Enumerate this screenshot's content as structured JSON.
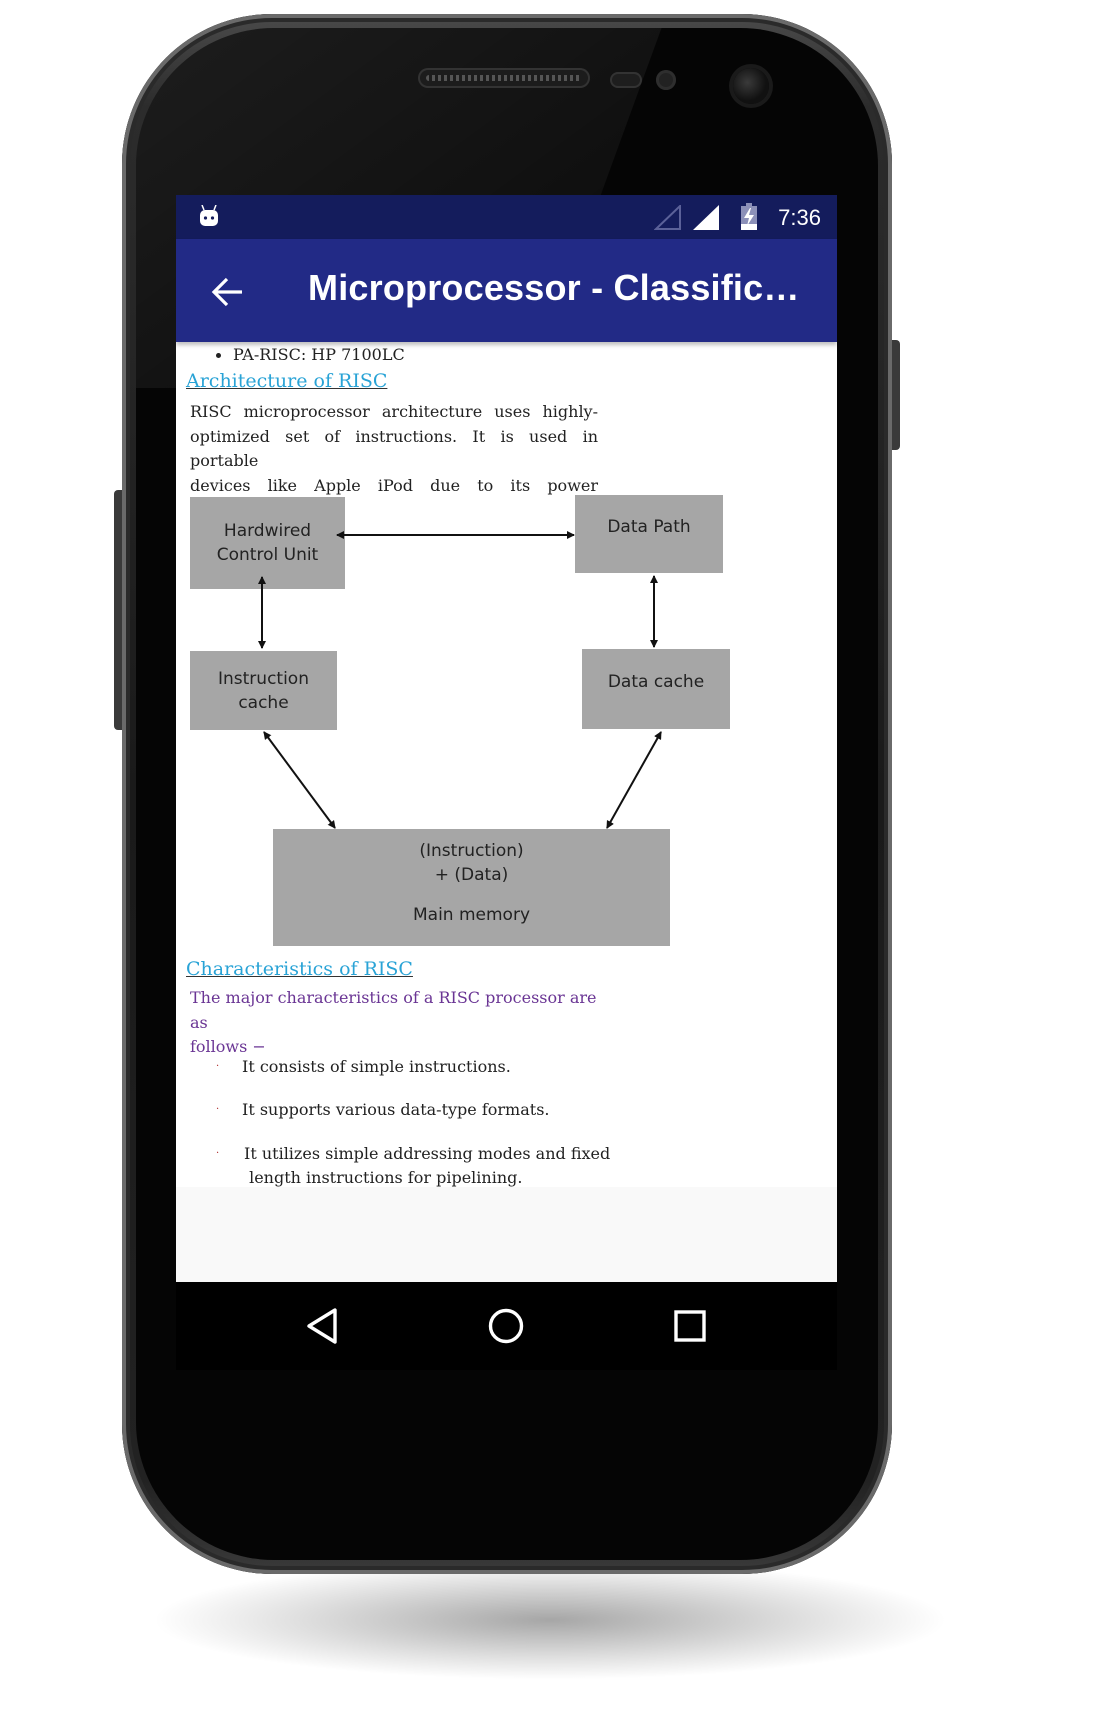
{
  "status_bar": {
    "time": "7:36",
    "icons": [
      "android-notification-icon",
      "signal-empty-icon",
      "signal-full-icon",
      "battery-charging-icon"
    ]
  },
  "app_bar": {
    "back_icon": "arrow-left-icon",
    "title": "Microprocessor - Classifica..."
  },
  "content": {
    "top_bullet": "PA-RISC: HP 7100LC",
    "architecture": {
      "heading": "Architecture of RISC",
      "paragraph_lines": [
        "RISC microprocessor architecture uses highly-",
        "optimized set of instructions. It is used in portable",
        "devices like Apple iPod due to its power efficiency."
      ]
    },
    "diagram": {
      "boxes": {
        "control_unit": [
          "Hardwired",
          "Control Unit"
        ],
        "data_path": [
          "Data Path"
        ],
        "instruction_cache": [
          "Instruction",
          "cache"
        ],
        "data_cache": [
          "Data cache"
        ],
        "main_memory": [
          "(Instruction)",
          "+ (Data)",
          "Main memory"
        ]
      },
      "connections": [
        {
          "from": "Hardwired Control Unit",
          "to": "Data Path",
          "type": "bidirectional"
        },
        {
          "from": "Hardwired Control Unit",
          "to": "Instruction cache",
          "type": "bidirectional"
        },
        {
          "from": "Data Path",
          "to": "Data cache",
          "type": "bidirectional"
        },
        {
          "from": "Instruction cache",
          "to": "Main memory",
          "type": "bidirectional"
        },
        {
          "from": "Data cache",
          "to": "Main memory",
          "type": "bidirectional"
        }
      ]
    },
    "characteristics": {
      "heading": "Characteristics of RISC",
      "intro_lines": [
        "The major characteristics of a RISC processor are as",
        "follows −"
      ],
      "items": [
        {
          "marker": "·",
          "lines": [
            "It consists of simple instructions."
          ]
        },
        {
          "marker": "·",
          "lines": [
            "It supports various data-type formats."
          ]
        },
        {
          "marker": "·",
          "lines": [
            "It utilizes simple addressing modes and fixed",
            " length instructions for pipelining."
          ]
        }
      ]
    }
  },
  "nav_bar": {
    "back": "triangle-back-icon",
    "home": "circle-home-icon",
    "recents": "square-recents-icon"
  },
  "colors": {
    "status_bar": "#141c5c",
    "app_bar": "#222a86",
    "link": "#29a3d6",
    "intro_text": "#6a3594",
    "diagram_box": "#a6a6a6"
  }
}
